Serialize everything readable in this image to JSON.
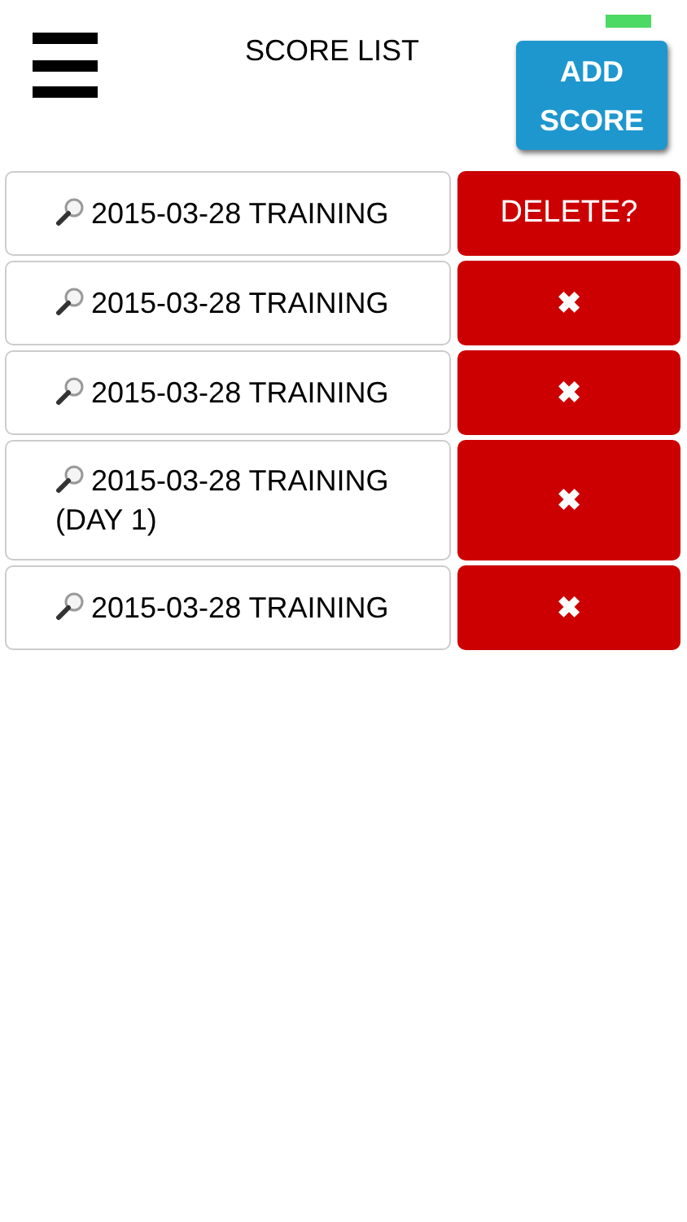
{
  "header": {
    "title": "SCORE LIST",
    "add_button": {
      "line_1": "ADD",
      "line_2": "SCORE"
    }
  },
  "scores": [
    {
      "label": "2015-03-28 TRAINING",
      "delete_label": "DELETE?",
      "confirming": true
    },
    {
      "label": "2015-03-28 TRAINING",
      "delete_label": "✖",
      "confirming": false
    },
    {
      "label": "2015-03-28 TRAINING",
      "delete_label": "✖",
      "confirming": false
    },
    {
      "label": "2015-03-28 TRAINING (DAY 1)",
      "delete_label": "✖",
      "confirming": false
    },
    {
      "label": "2015-03-28 TRAINING",
      "delete_label": "✖",
      "confirming": false
    }
  ]
}
